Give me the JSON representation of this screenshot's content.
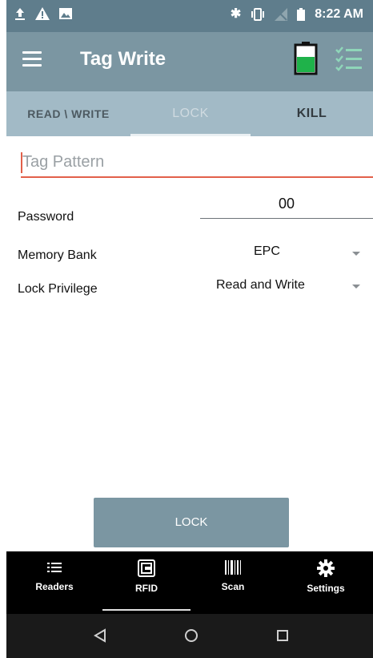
{
  "status_bar": {
    "time": "8:22 AM"
  },
  "app_bar": {
    "title": "Tag Write"
  },
  "tabs": [
    {
      "label": "READ \\ WRITE"
    },
    {
      "label": "LOCK"
    },
    {
      "label": "KILL"
    }
  ],
  "form": {
    "tag_pattern_placeholder": "Tag Pattern",
    "password_label": "Password",
    "password_value": "00",
    "memory_bank_label": "Memory Bank",
    "memory_bank_value": "EPC",
    "lock_privilege_label": "Lock Privilege",
    "lock_privilege_value": "Read and Write"
  },
  "lock_button": {
    "label": "LOCK"
  },
  "bottom_nav": [
    {
      "label": "Readers",
      "icon": "list-icon"
    },
    {
      "label": "RFID",
      "icon": "rfid-icon"
    },
    {
      "label": "Scan",
      "icon": "barcode-icon"
    },
    {
      "label": "Settings",
      "icon": "gear-icon"
    }
  ],
  "colors": {
    "primary": "#7b96a2",
    "status_bar": "#5f7d8c",
    "tab_bar": "#a2bac6",
    "accent": "#e2604a",
    "battery_green": "#1fb24a"
  }
}
